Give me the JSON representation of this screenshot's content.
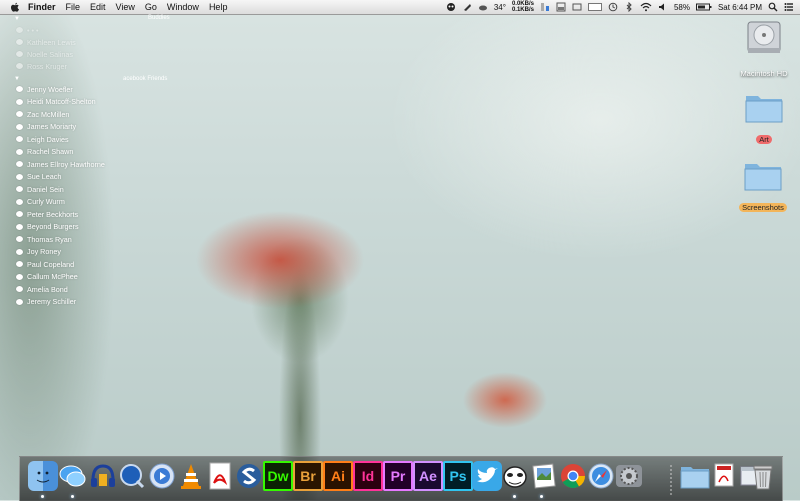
{
  "menubar": {
    "app_name": "Finder",
    "menus": [
      "File",
      "Edit",
      "View",
      "Go",
      "Window",
      "Help"
    ],
    "temperature": "34°",
    "net_up": "0.0KB/s",
    "net_down": "0.1KB/s",
    "battery_percent": "58%",
    "clock": "Sat 6:44 PM"
  },
  "buddy_list": {
    "buddies_header": "Buddies",
    "fb_header": "acebook Friends",
    "group1": [
      "Kathleen Lewis",
      "Noelle Salinas",
      "Ross Kruger"
    ],
    "group2": [
      "Jenny Woefler",
      "Heidi Matcoff-Shelton",
      "Zac McMillen",
      "James Moriarty",
      "Leigh Davies",
      "Rachel Shawn",
      "James Ellroy Hawthorne",
      "Sue Leach",
      "Daniel Sein",
      "Curly Wurm",
      "Peter Beckhorts",
      "Beyond Burgers",
      "Thomas Ryan",
      "Joy Roney",
      "Paul Copeland",
      "Callum McPhee",
      "Amelia Bond",
      "Jeremy Schiller"
    ]
  },
  "desktop": {
    "hd_label": "Macintosh HD",
    "folder1_label": "Art",
    "folder2_label": "Screenshots"
  },
  "dock": {
    "apps": [
      "finder",
      "messages",
      "headphones",
      "quicktime",
      "itunes",
      "vlc",
      "acrobat",
      "safari-s",
      "Dw",
      "Br",
      "Ai",
      "Id",
      "Pr",
      "Ae",
      "Ps",
      "twitter",
      "alien",
      "preview",
      "chrome",
      "safari",
      "prefs"
    ],
    "adobe_colors": {
      "Dw": "#35fa00",
      "Br": "#e9a13a",
      "Ai": "#ff7f18",
      "Id": "#ff3399",
      "Pr": "#e579ff",
      "Ae": "#d291ff",
      "Ps": "#31c5f0"
    }
  }
}
